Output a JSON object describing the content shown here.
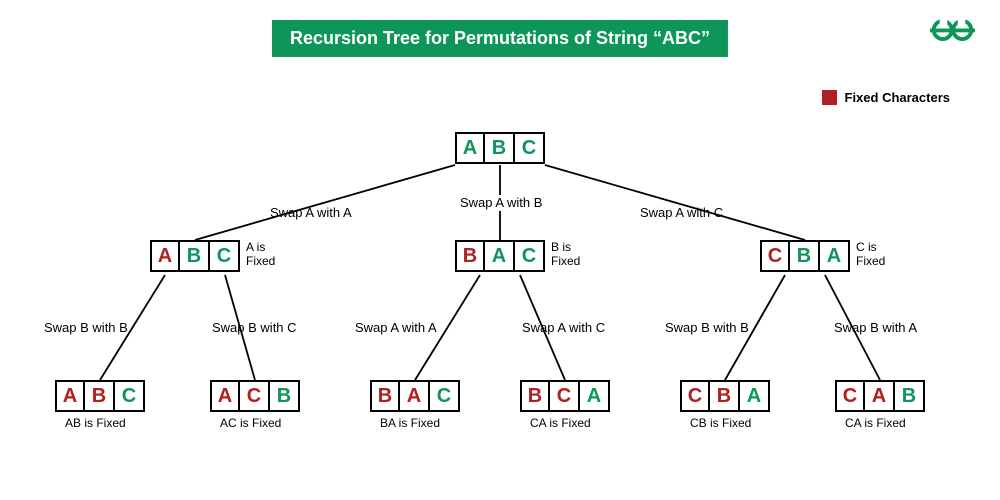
{
  "title": "Recursion Tree for Permutations of String “ABC”",
  "legend": "Fixed Characters",
  "root": {
    "c": [
      "A",
      "B",
      "C"
    ],
    "f": [
      false,
      false,
      false
    ]
  },
  "l1": {
    "n0": {
      "c": [
        "A",
        "B",
        "C"
      ],
      "f": [
        true,
        false,
        false
      ],
      "side": "A is\nFixed",
      "edge": "Swap A with A"
    },
    "n1": {
      "c": [
        "B",
        "A",
        "C"
      ],
      "f": [
        true,
        false,
        false
      ],
      "side": "B is\nFixed",
      "edge": "Swap A with B"
    },
    "n2": {
      "c": [
        "C",
        "B",
        "A"
      ],
      "f": [
        true,
        false,
        false
      ],
      "side": "C is\nFixed",
      "edge": "Swap A with C"
    }
  },
  "l2": {
    "n00": {
      "c": [
        "A",
        "B",
        "C"
      ],
      "f": [
        true,
        true,
        false
      ],
      "below": "AB is Fixed",
      "edge": "Swap B with B"
    },
    "n01": {
      "c": [
        "A",
        "C",
        "B"
      ],
      "f": [
        true,
        true,
        false
      ],
      "below": "AC is Fixed",
      "edge": "Swap B with C"
    },
    "n10": {
      "c": [
        "B",
        "A",
        "C"
      ],
      "f": [
        true,
        true,
        false
      ],
      "below": "BA is Fixed",
      "edge": "Swap A with A"
    },
    "n11": {
      "c": [
        "B",
        "C",
        "A"
      ],
      "f": [
        true,
        true,
        false
      ],
      "below": "CA is Fixed",
      "edge": "Swap A with C"
    },
    "n20": {
      "c": [
        "C",
        "B",
        "A"
      ],
      "f": [
        true,
        true,
        false
      ],
      "below": "CB is Fixed",
      "edge": "Swap B with B"
    },
    "n21": {
      "c": [
        "C",
        "A",
        "B"
      ],
      "f": [
        true,
        true,
        false
      ],
      "below": "CA is Fixed",
      "edge": "Swap B with A"
    }
  }
}
